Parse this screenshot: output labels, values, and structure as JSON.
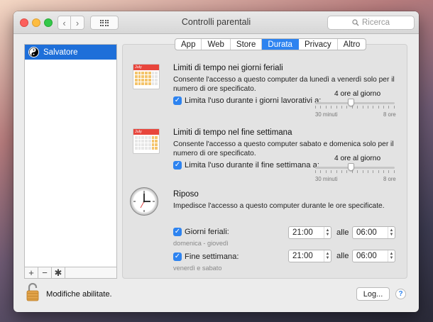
{
  "window": {
    "title": "Controlli parentali",
    "search_placeholder": "Ricerca"
  },
  "sidebar": {
    "users": [
      {
        "name": "Salvatore"
      }
    ],
    "add_symbol": "+",
    "remove_symbol": "−",
    "gear_symbol": "✱"
  },
  "tabs": [
    {
      "label": "App",
      "active": false
    },
    {
      "label": "Web",
      "active": false
    },
    {
      "label": "Store",
      "active": false
    },
    {
      "label": "Durata",
      "active": true
    },
    {
      "label": "Privacy",
      "active": false
    },
    {
      "label": "Altro",
      "active": false
    }
  ],
  "weekdays": {
    "title": "Limiti di tempo nei giorni feriali",
    "description": "Consente l'accesso a questo computer da lunedì a venerdì solo per il numero di ore specificato.",
    "checkbox_label": "Limita l'uso durante i giorni lavorativi a:",
    "checked": true,
    "slider_value_label": "4 ore al giorno",
    "slider_fraction": 0.45,
    "slider_min": "30 minuti",
    "slider_max": "8 ore",
    "calendar_month": "July"
  },
  "weekend": {
    "title": "Limiti di tempo nel fine settimana",
    "description": "Consente l'accesso a questo computer sabato e domenica solo per il numero di ore specificato.",
    "checkbox_label": "Limita l'uso durante il fine settimana a:",
    "checked": true,
    "slider_value_label": "4 ore al giorno",
    "slider_fraction": 0.45,
    "slider_min": "30 minuti",
    "slider_max": "8 ore",
    "calendar_month": "July"
  },
  "bedtime": {
    "title": "Riposo",
    "description": "Impedisce l'accesso a questo computer durante le ore specificate.",
    "alle_label": "alle",
    "weeknights": {
      "label": "Giorni feriali:",
      "sublabel": "domenica - giovedì",
      "checked": true,
      "start": "21:00",
      "end": "06:00"
    },
    "weekend": {
      "label": "Fine settimana:",
      "sublabel": "venerdì e sabato",
      "checked": true,
      "start": "21:00",
      "end": "06:00"
    }
  },
  "footer": {
    "lock_text": "Modifiche abilitate.",
    "log_button": "Log...",
    "help_symbol": "?"
  },
  "colors": {
    "accent": "#2d83f0",
    "selection": "#1e6fd9"
  }
}
